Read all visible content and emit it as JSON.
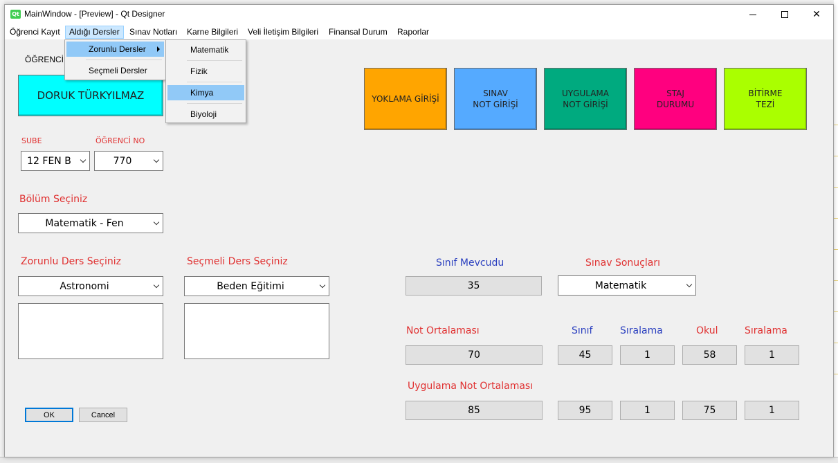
{
  "window": {
    "title": "MainWindow - [Preview] - Qt Designer",
    "icon_label": "Qt"
  },
  "menubar": [
    "Öğrenci Kayıt",
    "Aldığı Dersler",
    "Sınav Notları",
    "Karne Bilgileri",
    "Veli İletişim Bilgileri",
    "Finansal Durum",
    "Raporlar"
  ],
  "menu_aldigi": {
    "items": [
      "Zorunlu Dersler",
      "Seçmeli Dersler"
    ]
  },
  "menu_zorunlu": {
    "items": [
      "Matematik",
      "Fizik",
      "Kimya",
      "Biyoloji"
    ],
    "highlighted": "Kimya"
  },
  "student": {
    "label_partial": "ÖĞRENCİ .",
    "name": "DORUK TÜRKYILMAZ",
    "name_color": "#00ffff",
    "sube_label": "SUBE",
    "sube_value": "12 FEN B",
    "ogrenci_no_label": "ÖĞRENCİ NO",
    "ogrenci_no_value": "770"
  },
  "bolum": {
    "label": "Bölüm Seçiniz",
    "value": "Matematik - Fen"
  },
  "zorunlu": {
    "label": "Zorunlu Ders Seçiniz",
    "value": "Astronomi"
  },
  "secmeli": {
    "label": "Seçmeli Ders Seçiniz",
    "value": "Beden Eğitimi"
  },
  "action_buttons": [
    {
      "label": "YOKLAMA GİRİŞİ",
      "color": "#ffa500"
    },
    {
      "label": "SINAV\nNOT GİRİŞİ",
      "color": "#55aaff"
    },
    {
      "label": "UYGULAMA\nNOT GİRİŞİ",
      "color": "#00aa7f"
    },
    {
      "label": "STAJ\nDURUMU",
      "color": "#ff007f"
    },
    {
      "label": "BİTİRME\nTEZİ",
      "color": "#aaff00"
    }
  ],
  "stats": {
    "sinif_mevcudu_label": "Sınıf Mevcudu",
    "sinif_mevcudu_value": "35",
    "sinav_sonuclari_label": "Sınav Sonuçları",
    "sinav_sonuclari_value": "Matematik",
    "not_ortalamasi_label": "Not Ortalaması",
    "not_ortalamasi_value": "70",
    "col_sinif": "Sınıf",
    "col_siralama1": "Sıralama",
    "col_okul": "Okul",
    "col_siralama2": "Sıralama",
    "row1": {
      "sinif": "45",
      "siralama1": "1",
      "okul": "58",
      "siralama2": "1"
    },
    "uygulama_label": "Uygulama Not Ortalaması",
    "uygulama_value": "85",
    "row2": {
      "sinif": "95",
      "siralama1": "1",
      "okul": "75",
      "siralama2": "1"
    }
  },
  "dialog_buttons": {
    "ok": "OK",
    "cancel": "Cancel"
  }
}
